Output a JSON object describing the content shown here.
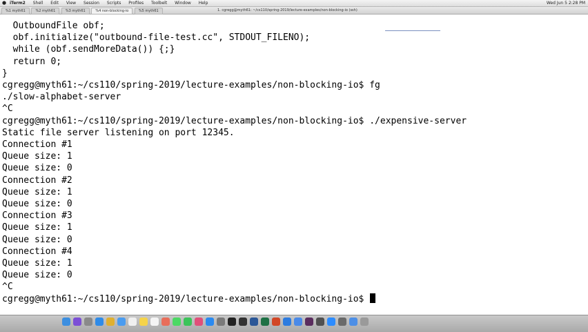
{
  "menubar": {
    "app_name": "iTerm2",
    "menus": [
      "Shell",
      "Edit",
      "View",
      "Session",
      "Scripts",
      "Profiles",
      "Toolbelt",
      "Window",
      "Help"
    ],
    "clock": "Wed Jun 5  2:28 PM"
  },
  "window": {
    "title": "1. cgregg@myth61: ~/cs110/spring-2019/lecture-examples/non-blocking-io (ssh)",
    "tabs": [
      "%1 myth61",
      "%2 myth61",
      "%3 myth61",
      "%4 non-blocking-io",
      "%5 myth61"
    ]
  },
  "terminal": {
    "lines": [
      {
        "text": "  OutboundFile obf;"
      },
      {
        "text": "  obf.initialize(\"outbound-file-test.cc\", STDOUT_FILENO);"
      },
      {
        "text": "  while (obf.sendMoreData()) {;}"
      },
      {
        "text": "  return 0;"
      },
      {
        "text": "}"
      },
      {
        "prompt": "cgregg@myth61:~/cs110/spring-2019/lecture-examples/non-blocking-io$",
        "command": " fg"
      },
      {
        "text": "./slow-alphabet-server"
      },
      {
        "text": "^C"
      },
      {
        "prompt": "cgregg@myth61:~/cs110/spring-2019/lecture-examples/non-blocking-io$",
        "command": " ./expensive-server"
      },
      {
        "text": "Static file server listening on port 12345."
      },
      {
        "text": "Connection #1"
      },
      {
        "text": "Queue size: 1"
      },
      {
        "text": "Queue size: 0"
      },
      {
        "text": "Connection #2"
      },
      {
        "text": "Queue size: 1"
      },
      {
        "text": "Queue size: 0"
      },
      {
        "text": "Connection #3"
      },
      {
        "text": "Queue size: 1"
      },
      {
        "text": "Queue size: 0"
      },
      {
        "text": "Connection #4"
      },
      {
        "text": "Queue size: 1"
      },
      {
        "text": "Queue size: 0"
      },
      {
        "text": "^C"
      },
      {
        "prompt": "cgregg@myth61:~/cs110/spring-2019/lecture-examples/non-blocking-io$",
        "command": " ",
        "cursor": true
      }
    ]
  },
  "dock": {
    "icons": [
      {
        "name": "finder-icon",
        "color": "#3d8fe0"
      },
      {
        "name": "siri-icon",
        "color": "#7c4fd6"
      },
      {
        "name": "launchpad-icon",
        "color": "#8a8a8a"
      },
      {
        "name": "safari-icon",
        "color": "#2f8be8"
      },
      {
        "name": "chrome-icon",
        "color": "#e0b030"
      },
      {
        "name": "mail-icon",
        "color": "#4a9cf0"
      },
      {
        "name": "calendar-icon",
        "color": "#f0f0f0"
      },
      {
        "name": "notes-icon",
        "color": "#f5d34a"
      },
      {
        "name": "reminders-icon",
        "color": "#f5f5f5"
      },
      {
        "name": "photos-icon",
        "color": "#e86e5a"
      },
      {
        "name": "messages-icon",
        "color": "#4cd964"
      },
      {
        "name": "facetime-icon",
        "color": "#3cc45a"
      },
      {
        "name": "itunes-icon",
        "color": "#e0507a"
      },
      {
        "name": "appstore-icon",
        "color": "#2a8af0"
      },
      {
        "name": "preferences-icon",
        "color": "#7a7a7a"
      },
      {
        "name": "terminal-icon",
        "color": "#222222"
      },
      {
        "name": "iterm-icon",
        "color": "#333333"
      },
      {
        "name": "word-icon",
        "color": "#2b5797"
      },
      {
        "name": "excel-icon",
        "color": "#1e7145"
      },
      {
        "name": "powerpoint-icon",
        "color": "#d24726"
      },
      {
        "name": "keynote-icon",
        "color": "#2d7ce0"
      },
      {
        "name": "xcode-icon",
        "color": "#4a8ae8"
      },
      {
        "name": "slack-icon",
        "color": "#5a2d5e"
      },
      {
        "name": "quicktime-icon",
        "color": "#505050"
      },
      {
        "name": "zoom-icon",
        "color": "#2d8cff"
      },
      {
        "name": "grapher-icon",
        "color": "#6a6a6a"
      },
      {
        "name": "downloads-icon",
        "color": "#4d8fe6"
      },
      {
        "name": "trash-icon",
        "color": "#9a9a9a"
      }
    ]
  }
}
